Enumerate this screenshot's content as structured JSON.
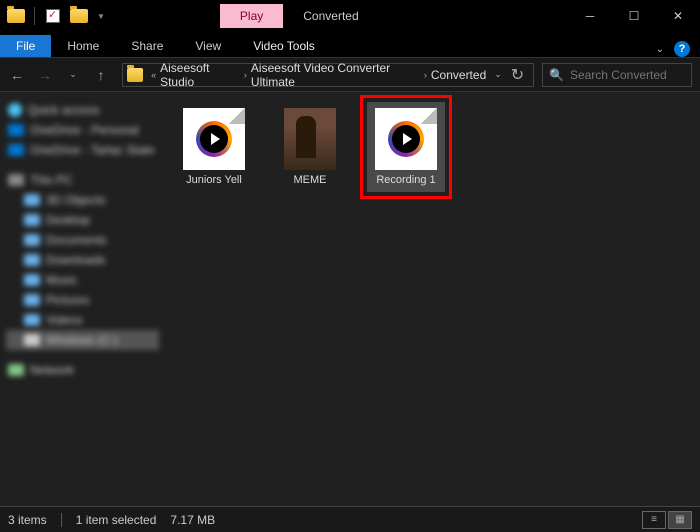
{
  "window": {
    "title": "Converted",
    "context_tab": "Play",
    "ribbon": {
      "file": "File",
      "tabs": [
        "Home",
        "Share",
        "View"
      ],
      "context_tab": "Video Tools"
    }
  },
  "nav": {
    "breadcrumbs": [
      "Aiseesoft Studio",
      "Aiseesoft Video Converter Ultimate",
      "Converted"
    ],
    "search_placeholder": "Search Converted"
  },
  "sidebar": {
    "items": [
      {
        "label": "Quick access",
        "icon": "star",
        "indent": 0
      },
      {
        "label": "OneDrive - Personal",
        "icon": "cloud",
        "indent": 0
      },
      {
        "label": "OneDrive - Tarlac State Un",
        "icon": "cloud",
        "indent": 0
      },
      {
        "label": "This PC",
        "icon": "pc",
        "indent": 0
      },
      {
        "label": "3D Objects",
        "icon": "folder",
        "indent": 1
      },
      {
        "label": "Desktop",
        "icon": "folder",
        "indent": 1
      },
      {
        "label": "Documents",
        "icon": "folder",
        "indent": 1
      },
      {
        "label": "Downloads",
        "icon": "folder",
        "indent": 1
      },
      {
        "label": "Music",
        "icon": "folder",
        "indent": 1
      },
      {
        "label": "Pictures",
        "icon": "folder",
        "indent": 1
      },
      {
        "label": "Videos",
        "icon": "folder",
        "indent": 1
      },
      {
        "label": "Windows (C:)",
        "icon": "drive",
        "indent": 1,
        "selected": true
      },
      {
        "label": "Network",
        "icon": "net",
        "indent": 0
      }
    ]
  },
  "files": [
    {
      "name": "Juniors Yell",
      "type": "video-doc",
      "selected": false,
      "highlighted": false
    },
    {
      "name": "MEME",
      "type": "video-thumb",
      "selected": false,
      "highlighted": false
    },
    {
      "name": "Recording 1",
      "type": "video-doc",
      "selected": true,
      "highlighted": true
    }
  ],
  "status": {
    "count": "3 items",
    "selection": "1 item selected",
    "size": "7.17 MB"
  }
}
